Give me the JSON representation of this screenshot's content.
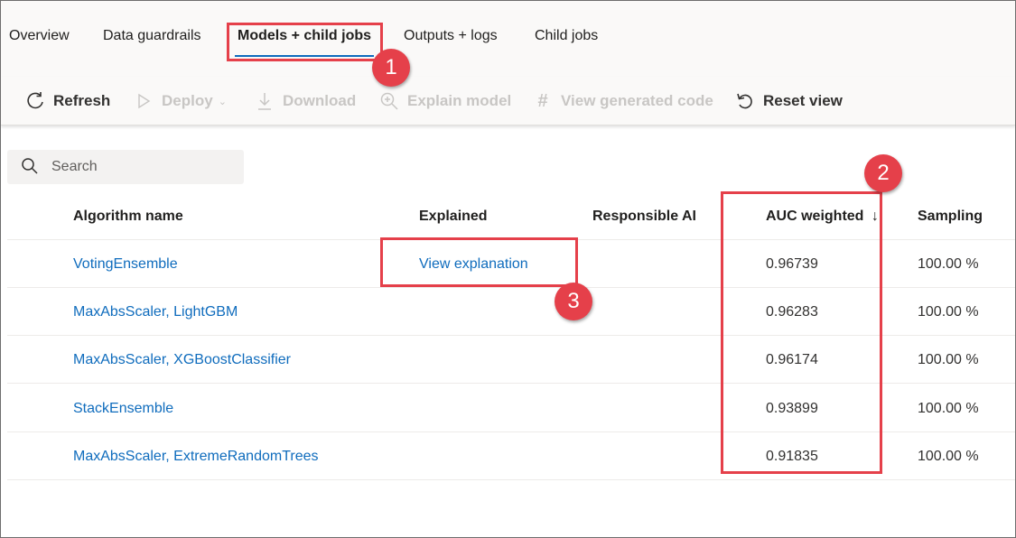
{
  "tabs": [
    {
      "label": "Overview"
    },
    {
      "label": "Data guardrails"
    },
    {
      "label": "Models + child jobs"
    },
    {
      "label": "Outputs + logs"
    },
    {
      "label": "Child jobs"
    }
  ],
  "toolbar": {
    "refresh": "Refresh",
    "deploy": "Deploy",
    "download": "Download",
    "explain_model": "Explain model",
    "view_generated_code": "View generated code",
    "reset_view": "Reset view"
  },
  "search": {
    "placeholder": "Search"
  },
  "table": {
    "columns": [
      "Algorithm name",
      "Explained",
      "Responsible AI",
      "AUC weighted",
      "Sampling"
    ],
    "sort_indicator": "↓",
    "rows": [
      {
        "algorithm": "VotingEnsemble",
        "explained": "View explanation",
        "auc": "0.96739",
        "sampling": "100.00 %"
      },
      {
        "algorithm": "MaxAbsScaler, LightGBM",
        "explained": "",
        "auc": "0.96283",
        "sampling": "100.00 %"
      },
      {
        "algorithm": "MaxAbsScaler, XGBoostClassifier",
        "explained": "",
        "auc": "0.96174",
        "sampling": "100.00 %"
      },
      {
        "algorithm": "StackEnsemble",
        "explained": "",
        "auc": "0.93899",
        "sampling": "100.00 %"
      },
      {
        "algorithm": "MaxAbsScaler, ExtremeRandomTrees",
        "explained": "",
        "auc": "0.91835",
        "sampling": "100.00 %"
      }
    ]
  },
  "annotations": {
    "badge1": "1",
    "badge2": "2",
    "badge3": "3"
  },
  "colors": {
    "accent": "#0f6cbd",
    "annotation": "#e5404a"
  }
}
